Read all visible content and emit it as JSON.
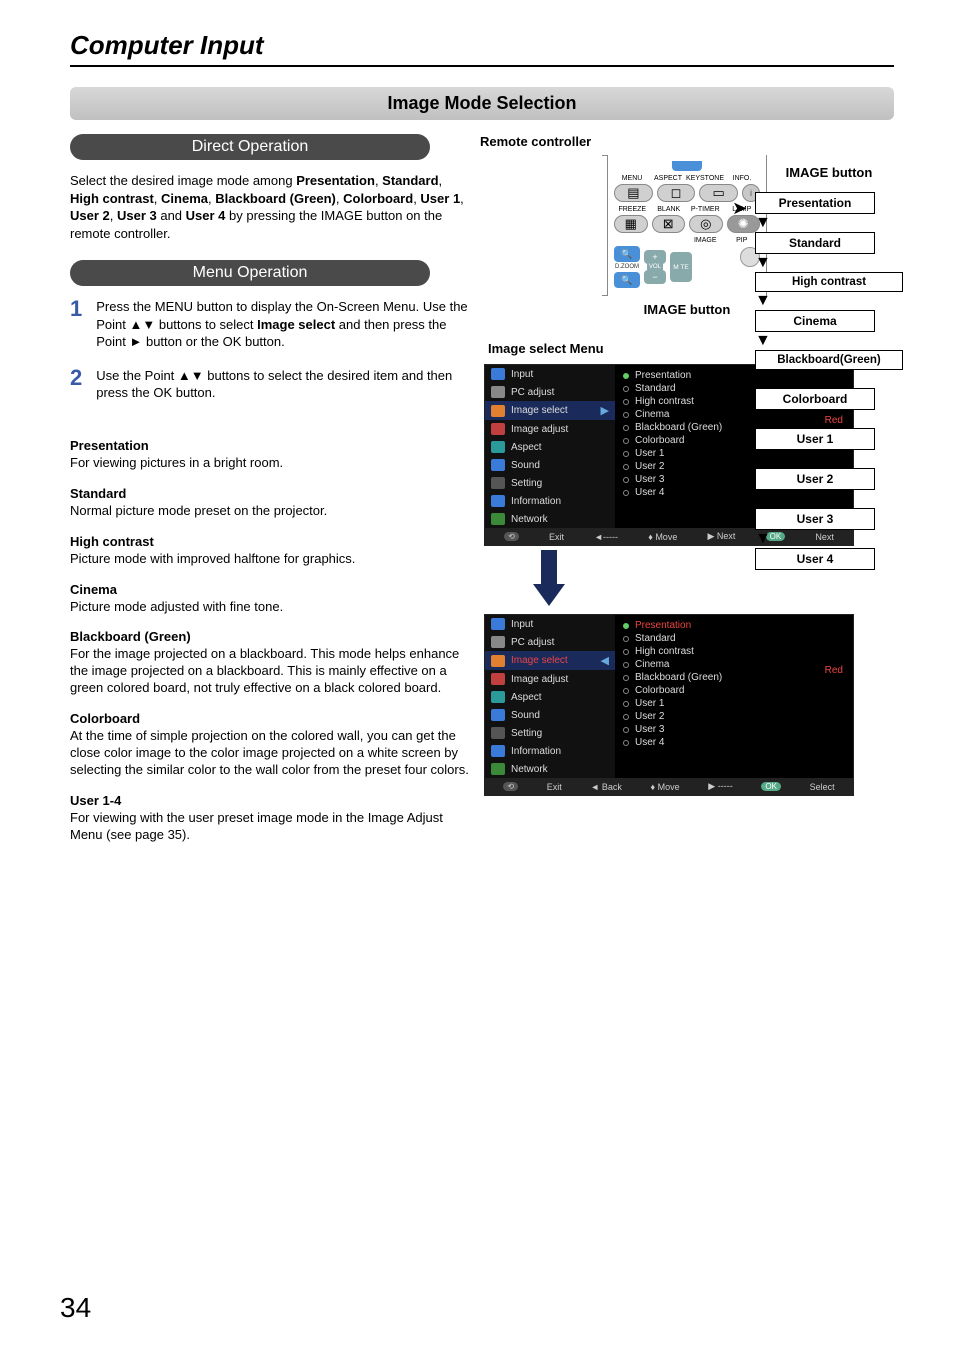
{
  "page": {
    "title": "Computer Input",
    "number": "34"
  },
  "section_banner": "Image Mode Selection",
  "pills": {
    "direct": "Direct Operation",
    "menu": "Menu Operation"
  },
  "direct_text_parts": {
    "pre": "Select the desired image mode among ",
    "b1": "Presentation",
    "c1": ", ",
    "b2": "Standard",
    "c2": ", ",
    "b3": "High contrast",
    "c3": ", ",
    "b4": "Cinema",
    "c4": ", ",
    "b5": "Blackboard (Green)",
    "c5": ", ",
    "b6": "Colorboard",
    "c6": ", ",
    "b7": "User 1",
    "c7": ", ",
    "b8": "User 2",
    "c8": ", ",
    "b9": "User 3",
    "c9": " and  ",
    "b10": "User 4",
    "post": " by pressing the IMAGE button on the remote controller."
  },
  "steps": [
    {
      "num": "1",
      "pre": "Press the MENU button to display the On-Screen Menu. Use the Point ▲▼ buttons to select ",
      "bold": "Image select",
      "post": " and then press the Point ► button or the OK button."
    },
    {
      "num": "2",
      "pre": "Use the Point ▲▼ buttons to select  the desired item and then press the OK button.",
      "bold": "",
      "post": ""
    }
  ],
  "modes": [
    {
      "title": "Presentation",
      "desc": "For viewing pictures in a bright room."
    },
    {
      "title": "Standard",
      "desc": "Normal picture mode preset on the projector."
    },
    {
      "title": "High contrast",
      "desc": "Picture mode with improved halftone for graphics."
    },
    {
      "title": "Cinema",
      "desc": "Picture mode adjusted with fine tone."
    },
    {
      "title": "Blackboard (Green)",
      "desc": "For the image projected on a blackboard. This mode helps enhance the image projected on a blackboard. This is mainly effective on a green colored board, not truly effective on a black colored board."
    },
    {
      "title": "Colorboard",
      "desc": "At the time of simple projection on the colored wall, you can get the close color image to the color image projected on a white screen by selecting the similar color to the wall color from the preset four colors."
    },
    {
      "title": "User 1-4",
      "desc": "For viewing with the user preset image mode in the Image Adjust Menu (see page 35)."
    }
  ],
  "remote": {
    "label": "Remote controller",
    "image_button_title": "IMAGE button",
    "image_button_caption": "IMAGE button",
    "row1": [
      "MENU",
      "ASPECT",
      "KEYSTONE",
      "INFO."
    ],
    "row2": [
      "FREEZE",
      "BLANK",
      "P-TIMER",
      "LAMP"
    ],
    "row3_label": "IMAGE",
    "row3_pip": "PIP",
    "dzoom": "D.ZOOM",
    "vol": "VOL",
    "mute_top": "MUTE",
    "mute_mid": "M TE"
  },
  "flow": [
    "Presentation",
    "Standard",
    "High contrast",
    "Cinema",
    "Blackboard(Green)",
    "Colorboard",
    "User 1",
    "User 2",
    "User 3",
    "User 4"
  ],
  "osd": {
    "title": "Image select Menu",
    "left_items": [
      {
        "icon": "blue",
        "label": "Input"
      },
      {
        "icon": "gray",
        "label": "PC adjust"
      },
      {
        "icon": "orange",
        "label": "Image select",
        "selected": true
      },
      {
        "icon": "red",
        "label": "Image adjust"
      },
      {
        "icon": "cyan",
        "label": "Aspect"
      },
      {
        "icon": "blue",
        "label": "Sound"
      },
      {
        "icon": "dgray",
        "label": "Setting"
      },
      {
        "icon": "blue",
        "label": "Information"
      },
      {
        "icon": "green",
        "label": "Network"
      }
    ],
    "options": [
      "Presentation",
      "Standard",
      "High contrast",
      "Cinema",
      "Blackboard (Green)",
      "Colorboard",
      "User 1",
      "User 2",
      "User 3",
      "User 4"
    ],
    "red_label": "Red",
    "footer1": {
      "exit": "Exit",
      "back": "◄-----",
      "move": "Move",
      "next": "Next",
      "ok": "Next"
    },
    "footer2": {
      "exit": "Exit",
      "back": "Back",
      "move": "Move",
      "next": "-----",
      "ok": "Select"
    }
  }
}
